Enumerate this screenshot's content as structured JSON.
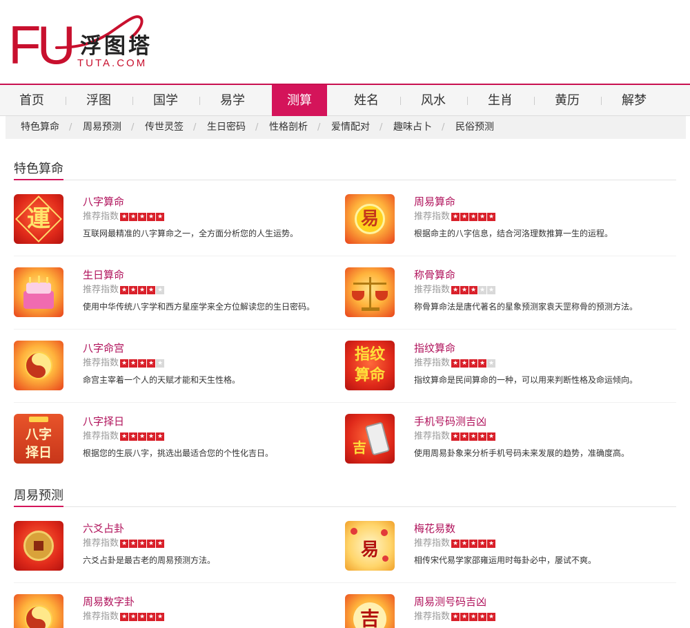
{
  "logo": {
    "mark": "FU",
    "name_cn": "浮图塔",
    "domain": "TUTA.COM"
  },
  "nav": {
    "items": [
      "首页",
      "浮图",
      "国学",
      "易学",
      "测算",
      "姓名",
      "风水",
      "生肖",
      "黄历",
      "解梦"
    ],
    "active_index": 4
  },
  "subnav": {
    "items": [
      "特色算命",
      "周易预测",
      "传世灵签",
      "生日密码",
      "性格剖析",
      "爱情配对",
      "趣味占卜",
      "民俗预测"
    ]
  },
  "rating_label": "推荐指数",
  "sections": [
    {
      "title": "特色算命",
      "items": [
        {
          "title": "八字算命",
          "stars": 5,
          "desc": "互联网最精准的八字算命之一，全方面分析您的人生运势。",
          "icon": "yun-character-icon",
          "icon_text": "運"
        },
        {
          "title": "周易算命",
          "stars": 5,
          "desc": "根据命主的八字信息，结合河洛理数推算一生的运程。",
          "icon": "yi-character-icon",
          "icon_text": "易"
        },
        {
          "title": "生日算命",
          "stars": 4,
          "desc": "使用中华传统八字学和西方星座学来全方位解读您的生日密码。",
          "icon": "birthday-cake-icon",
          "icon_text": ""
        },
        {
          "title": "称骨算命",
          "stars": 3,
          "desc": "称骨算命法是唐代著名的星象预测家袁天罡称骨的预测方法。",
          "icon": "scale-icon",
          "icon_text": ""
        },
        {
          "title": "八字命宫",
          "stars": 4,
          "desc": "命宫主宰着一个人的天赋才能和天生性格。",
          "icon": "yin-yang-icon",
          "icon_text": ""
        },
        {
          "title": "指纹算命",
          "stars": 4,
          "desc": "指纹算命是民间算命的一种，可以用来判断性格及命运倾向。",
          "icon": "fingerprint-text-icon",
          "icon_text": "指纹算命"
        },
        {
          "title": "八字择日",
          "stars": 5,
          "desc": "根据您的生辰八字，挑选出最适合您的个性化吉日。",
          "icon": "calendar-icon",
          "icon_text": "八字择日"
        },
        {
          "title": "手机号码测吉凶",
          "stars": 5,
          "desc": "使用周易卦象来分析手机号码未来发展的趋势，准确度高。",
          "icon": "mobile-phone-icon",
          "icon_text": "吉"
        }
      ]
    },
    {
      "title": "周易预测",
      "items": [
        {
          "title": "六爻占卦",
          "stars": 5,
          "desc": "六爻占卦是最古老的周易预测方法。",
          "icon": "coin-icon",
          "icon_text": ""
        },
        {
          "title": "梅花易数",
          "stars": 5,
          "desc": "相传宋代易学家邵雍运用时每卦必中，屡试不爽。",
          "icon": "plum-blossom-icon",
          "icon_text": "易"
        },
        {
          "title": "周易数字卦",
          "stars": 5,
          "desc": "",
          "icon": "yin-yang-icon",
          "icon_text": ""
        },
        {
          "title": "周易测号码吉凶",
          "stars": 5,
          "desc": "",
          "icon": "ji-character-icon",
          "icon_text": "吉"
        }
      ]
    }
  ],
  "colors": {
    "brand": "#c8102e",
    "accent": "#d4145a",
    "title": "#b0125b",
    "star": "#d9202a"
  }
}
